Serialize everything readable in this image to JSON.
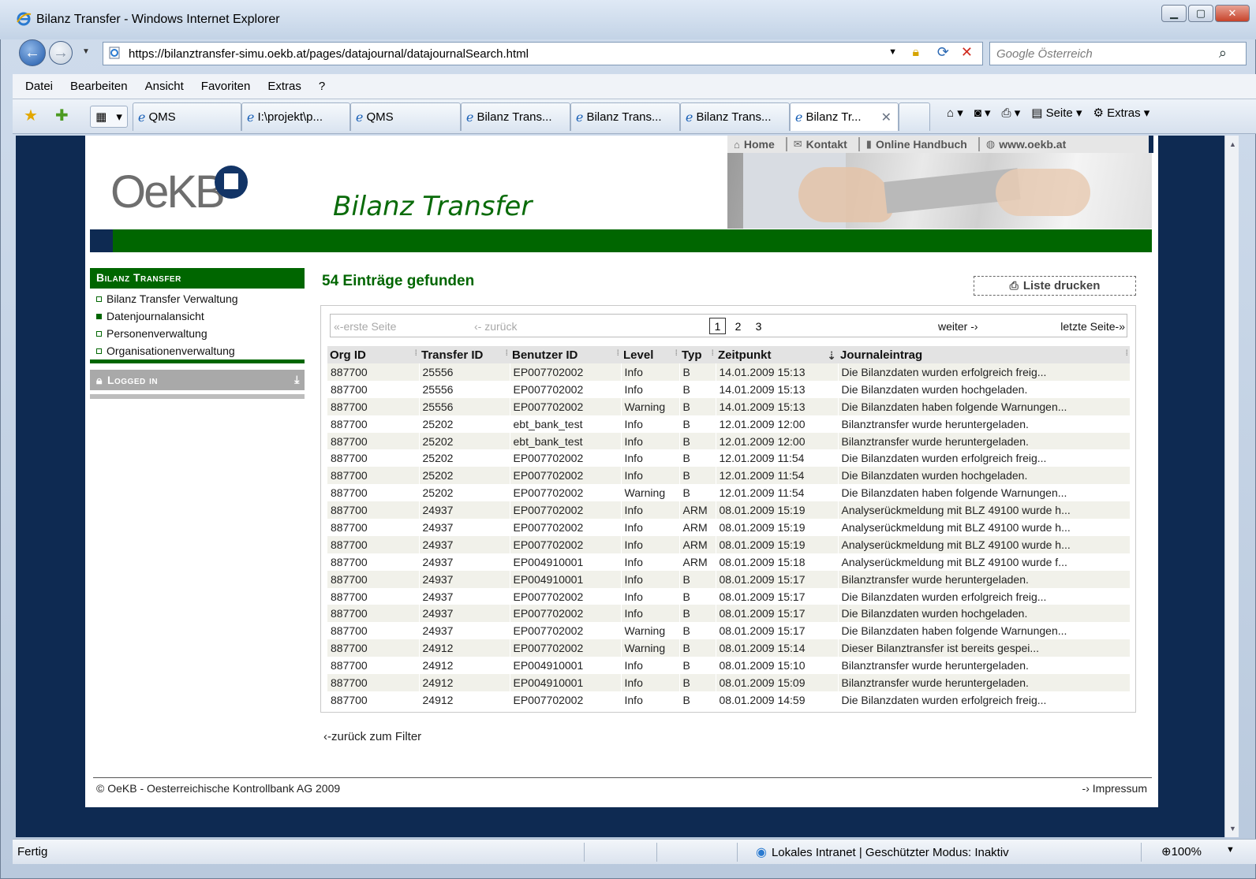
{
  "window": {
    "title": "Bilanz Transfer - Windows Internet Explorer",
    "url": "https://bilanztransfer-simu.oekb.at/pages/datajournal/datajournalSearch.html",
    "search_placeholder": "Google Österreich"
  },
  "menu": [
    "Datei",
    "Bearbeiten",
    "Ansicht",
    "Favoriten",
    "Extras",
    "?"
  ],
  "tabs": [
    {
      "label": "QMS"
    },
    {
      "label": "I:\\projekt\\p..."
    },
    {
      "label": "QMS"
    },
    {
      "label": "Bilanz Trans..."
    },
    {
      "label": "Bilanz Trans..."
    },
    {
      "label": "Bilanz Trans..."
    },
    {
      "label": "Bilanz Tr..."
    }
  ],
  "commandbar": {
    "page": "Seite",
    "tools": "Extras"
  },
  "site": {
    "toplinks": [
      "Home",
      "Kontakt",
      "Online Handbuch",
      "www.oekb.at"
    ],
    "logo": "OeKB",
    "app_title": "Bilanz Transfer"
  },
  "sidebar": {
    "heading": "Bilanz Transfer",
    "items": [
      "Bilanz Transfer Verwaltung",
      "Datenjournalansicht",
      "Personenverwaltung",
      "Organisationenverwaltung"
    ],
    "logged_in": "Logged in"
  },
  "main": {
    "found_text": "54 Einträge gefunden",
    "print_label": "Liste drucken",
    "pager": {
      "first": "«-erste Seite",
      "prev": "‹- zurück",
      "pages": [
        "1",
        "2",
        "3"
      ],
      "current_page": "1",
      "next": "weiter -›",
      "last": "letzte Seite-»"
    },
    "columns": [
      "Org ID",
      "Transfer ID",
      "Benutzer ID",
      "Level",
      "Typ",
      "Zeitpunkt",
      "Journaleintrag"
    ],
    "rows": [
      [
        "887700",
        "25556",
        "EP007702002",
        "Info",
        "B",
        "14.01.2009 15:13",
        "Die Bilanzdaten wurden erfolgreich freig..."
      ],
      [
        "887700",
        "25556",
        "EP007702002",
        "Info",
        "B",
        "14.01.2009 15:13",
        "Die Bilanzdaten wurden hochgeladen."
      ],
      [
        "887700",
        "25556",
        "EP007702002",
        "Warning",
        "B",
        "14.01.2009 15:13",
        "Die Bilanzdaten haben folgende Warnungen..."
      ],
      [
        "887700",
        "25202",
        "ebt_bank_test",
        "Info",
        "B",
        "12.01.2009 12:00",
        "Bilanztransfer wurde heruntergeladen."
      ],
      [
        "887700",
        "25202",
        "ebt_bank_test",
        "Info",
        "B",
        "12.01.2009 12:00",
        "Bilanztransfer wurde heruntergeladen."
      ],
      [
        "887700",
        "25202",
        "EP007702002",
        "Info",
        "B",
        "12.01.2009 11:54",
        "Die Bilanzdaten wurden erfolgreich freig..."
      ],
      [
        "887700",
        "25202",
        "EP007702002",
        "Info",
        "B",
        "12.01.2009 11:54",
        "Die Bilanzdaten wurden hochgeladen."
      ],
      [
        "887700",
        "25202",
        "EP007702002",
        "Warning",
        "B",
        "12.01.2009 11:54",
        "Die Bilanzdaten haben folgende Warnungen..."
      ],
      [
        "887700",
        "24937",
        "EP007702002",
        "Info",
        "ARM",
        "08.01.2009 15:19",
        "Analyserückmeldung mit BLZ 49100 wurde h..."
      ],
      [
        "887700",
        "24937",
        "EP007702002",
        "Info",
        "ARM",
        "08.01.2009 15:19",
        "Analyserückmeldung mit BLZ 49100 wurde h..."
      ],
      [
        "887700",
        "24937",
        "EP007702002",
        "Info",
        "ARM",
        "08.01.2009 15:19",
        "Analyserückmeldung mit BLZ 49100 wurde h..."
      ],
      [
        "887700",
        "24937",
        "EP004910001",
        "Info",
        "ARM",
        "08.01.2009 15:18",
        "Analyserückmeldung mit BLZ 49100 wurde f..."
      ],
      [
        "887700",
        "24937",
        "EP004910001",
        "Info",
        "B",
        "08.01.2009 15:17",
        "Bilanztransfer wurde heruntergeladen."
      ],
      [
        "887700",
        "24937",
        "EP007702002",
        "Info",
        "B",
        "08.01.2009 15:17",
        "Die Bilanzdaten wurden erfolgreich freig..."
      ],
      [
        "887700",
        "24937",
        "EP007702002",
        "Info",
        "B",
        "08.01.2009 15:17",
        "Die Bilanzdaten wurden hochgeladen."
      ],
      [
        "887700",
        "24937",
        "EP007702002",
        "Warning",
        "B",
        "08.01.2009 15:17",
        "Die Bilanzdaten haben folgende Warnungen..."
      ],
      [
        "887700",
        "24912",
        "EP007702002",
        "Warning",
        "B",
        "08.01.2009 15:14",
        "Dieser Bilanztransfer ist bereits gespei..."
      ],
      [
        "887700",
        "24912",
        "EP004910001",
        "Info",
        "B",
        "08.01.2009 15:10",
        "Bilanztransfer wurde heruntergeladen."
      ],
      [
        "887700",
        "24912",
        "EP004910001",
        "Info",
        "B",
        "08.01.2009 15:09",
        "Bilanztransfer wurde heruntergeladen."
      ],
      [
        "887700",
        "24912",
        "EP007702002",
        "Info",
        "B",
        "08.01.2009 14:59",
        "Die Bilanzdaten wurden erfolgreich freig..."
      ]
    ],
    "back_to_filter": "‹-zurück zum Filter"
  },
  "footer": {
    "copyright": "© OeKB - Oesterreichische Kontrollbank AG 2009",
    "impressum": "-› Impressum"
  },
  "status": {
    "text": "Fertig",
    "zone": "Lokales Intranet | Geschützter Modus: Inaktiv",
    "zoom": "100%"
  },
  "colors": {
    "brand_green": "#006600",
    "brand_blue": "#0e2a52"
  }
}
